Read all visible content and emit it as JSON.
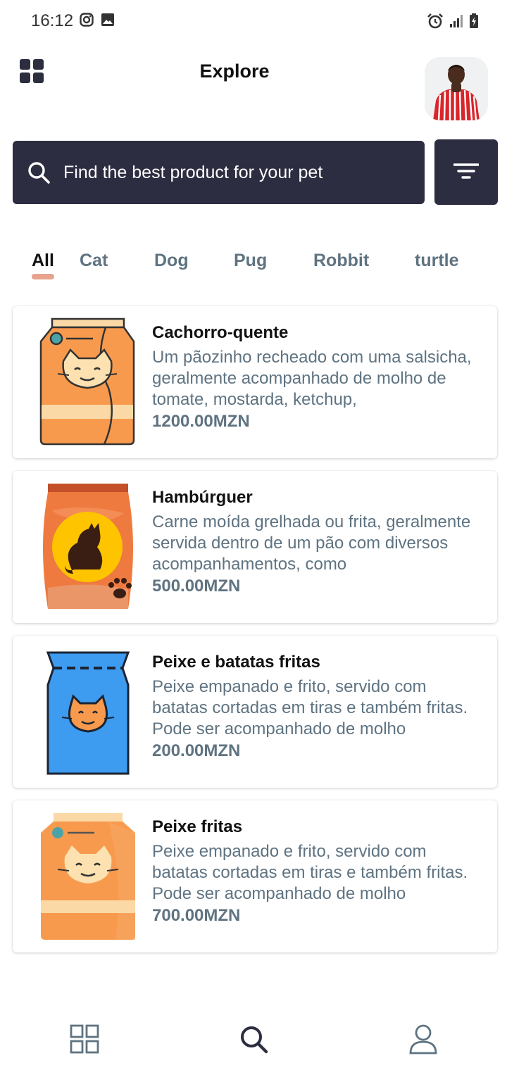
{
  "status_bar": {
    "time": "16:12",
    "left_icons": [
      "instagram-icon",
      "gallery-icon"
    ],
    "right_icons": [
      "alarm-icon",
      "signal-icon",
      "battery-charging-icon"
    ]
  },
  "header": {
    "title": "Explore",
    "menu_icon": "grid-icon",
    "avatar": "user-photo"
  },
  "search": {
    "placeholder": "Find the best product for your pet",
    "icon": "search-icon",
    "filter_icon": "filter-icon"
  },
  "categories": {
    "active": "All",
    "items": [
      {
        "label": "All"
      },
      {
        "label": "Cat"
      },
      {
        "label": "Dog"
      },
      {
        "label": "Pug"
      },
      {
        "label": "Robbit"
      },
      {
        "label": "turtle"
      }
    ],
    "indicator_color": "#e7a38e"
  },
  "products": [
    {
      "name": "Cachorro-quente",
      "description": "Um pãozinho recheado com uma salsicha, geralmente acompanhado de molho de tomate, mostarda, ketchup,",
      "price": "1200.00MZN",
      "image": "orange-cat-food-bag-icon"
    },
    {
      "name": "Hambúrguer",
      "description": "Carne moída grelhada ou frita, geralmente servida dentro de um pão com diversos acompanhamentos, como",
      "price": "500.00MZN",
      "image": "cat-silhouette-food-bag-icon"
    },
    {
      "name": "Peixe e batatas fritas",
      "description": "Peixe empanado e frito, servido com batatas cortadas em tiras e também fritas. Pode ser acompanhado de molho",
      "price": "200.00MZN",
      "image": "blue-cat-food-bag-icon"
    },
    {
      "name": "Peixe fritas",
      "description": "Peixe empanado e frito, servido com batatas cortadas em tiras e também fritas. Pode ser acompanhado de molho",
      "price": "700.00MZN",
      "image": "orange-cat-food-bag-icon"
    }
  ],
  "bottom_nav": {
    "items": [
      {
        "icon": "grid-outline-icon"
      },
      {
        "icon": "search-icon"
      },
      {
        "icon": "user-icon"
      }
    ]
  },
  "colors": {
    "dark": "#2c2d40",
    "muted_text": "#5f7381",
    "accent": "#e7a38e"
  }
}
